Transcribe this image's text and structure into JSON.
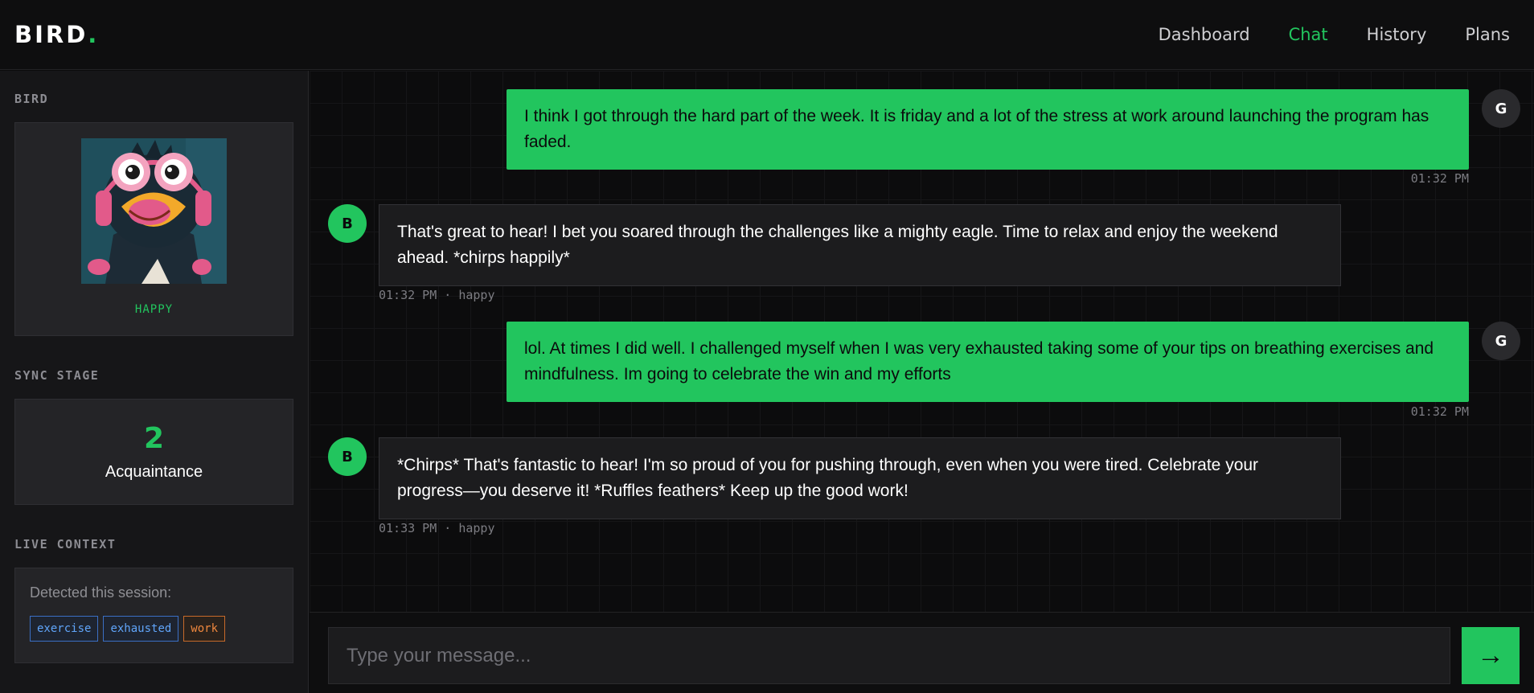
{
  "header": {
    "logo_text": "BIRD",
    "logo_dot": ".",
    "nav": [
      {
        "label": "Dashboard",
        "active": false
      },
      {
        "label": "Chat",
        "active": true
      },
      {
        "label": "History",
        "active": false
      },
      {
        "label": "Plans",
        "active": false
      }
    ]
  },
  "sidebar": {
    "bird_label": "BIRD",
    "bird_mood": "HAPPY",
    "sync_label": "SYNC STAGE",
    "sync_stage_number": "2",
    "sync_stage_name": "Acquaintance",
    "context_label": "LIVE CONTEXT",
    "context_title": "Detected this session:",
    "tags": [
      {
        "text": "exercise",
        "color": "#60a5fa"
      },
      {
        "text": "exhausted",
        "color": "#60a5fa"
      },
      {
        "text": "work",
        "color": "#f0883e"
      }
    ]
  },
  "messages": [
    {
      "sender": "user",
      "avatar": "G",
      "text": "I think I got through the hard part of the week. It is friday and a lot of the stress at work around launching the program has faded.",
      "meta": "01:32 PM"
    },
    {
      "sender": "bot",
      "avatar": "B",
      "text": "That's great to hear! I bet you soared through the challenges like a mighty eagle. Time to relax and enjoy the weekend ahead. *chirps happily*",
      "meta": "01:32 PM · happy"
    },
    {
      "sender": "user",
      "avatar": "G",
      "text": "lol. At times I did well. I challenged myself when I was very exhausted taking some of your tips on breathing exercises and mindfulness. Im going to celebrate the win and my efforts",
      "meta": "01:32 PM"
    },
    {
      "sender": "bot",
      "avatar": "B",
      "text": "*Chirps* That's fantastic to hear! I'm so proud of you for pushing through, even when you were tired. Celebrate your progress—you deserve it! *Ruffles feathers* Keep up the good work!",
      "meta": "01:33 PM · happy"
    }
  ],
  "composer": {
    "placeholder": "Type your message...",
    "send_glyph": "→"
  },
  "colors": {
    "accent": "#22c55e",
    "tag_blue": "#60a5fa",
    "tag_orange": "#f0883e"
  }
}
